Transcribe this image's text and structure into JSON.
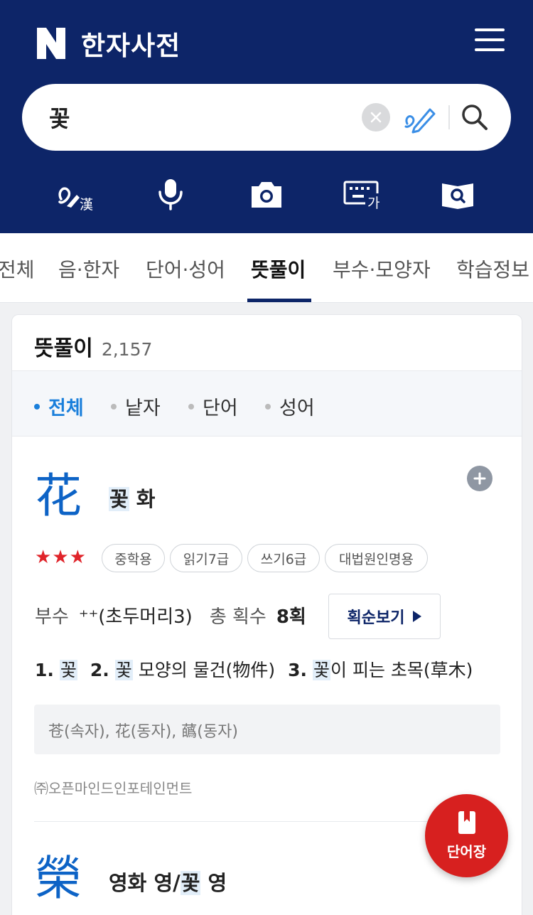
{
  "header": {
    "logo_letter": "N",
    "title": "한자사전",
    "menu_icon": "hamburger-menu-icon"
  },
  "search": {
    "value": "꽃",
    "clear_icon": "clear-icon",
    "handwriting_icon": "pen-icon",
    "search_icon": "search-icon"
  },
  "tools": [
    {
      "name": "handwriting-hanja-icon",
      "label": "漢"
    },
    {
      "name": "microphone-icon"
    },
    {
      "name": "camera-icon"
    },
    {
      "name": "keyboard-icon",
      "label": "가"
    },
    {
      "name": "book-search-icon"
    }
  ],
  "tabs": [
    {
      "label": "전체",
      "active": false
    },
    {
      "label": "음·한자",
      "active": false
    },
    {
      "label": "단어·성어",
      "active": false
    },
    {
      "label": "뜻풀이",
      "active": true
    },
    {
      "label": "부수·모양자",
      "active": false
    },
    {
      "label": "학습정보",
      "active": false
    }
  ],
  "card": {
    "title": "뜻풀이",
    "count": "2,157",
    "filters": [
      {
        "label": "전체",
        "active": true
      },
      {
        "label": "낱자",
        "active": false
      },
      {
        "label": "단어",
        "active": false
      },
      {
        "label": "성어",
        "active": false
      }
    ]
  },
  "entry1": {
    "hanja": "花",
    "meaning_hl": "꽃",
    "meaning_rest": " 화",
    "stars": 3,
    "badges": [
      "중학용",
      "읽기7급",
      "쓰기6급",
      "대법원인명용"
    ],
    "radical_label": "부수",
    "radical_value": "⁺⁺(초두머리3)",
    "strokes_label": "총 획수",
    "strokes_value": "8획",
    "stroke_button": "획순보기",
    "defs": [
      {
        "num": "1.",
        "hl": "꽃",
        "rest": ""
      },
      {
        "num": "2.",
        "hl": "꽃",
        "rest": " 모양의 물건(物件)"
      },
      {
        "num": "3.",
        "hl": "꽃",
        "rest": "이 피는 초목(草木)"
      }
    ],
    "variants": "苍(속자), 花(동자), 蘤(동자)",
    "source": "㈜오픈마인드인포테인먼트"
  },
  "entry2": {
    "hanja": "榮",
    "meaning_pre": "영화 영/",
    "meaning_hl": "꽃",
    "meaning_rest": " 영"
  },
  "fab": {
    "label": "단어장",
    "icon": "bookmark-book-icon"
  },
  "colors": {
    "header_bg": "#0d2568",
    "accent_blue": "#1a7fdb",
    "hanja_blue": "#0d63c6",
    "star_red": "#e0242a",
    "fab_red": "#d7201f"
  }
}
